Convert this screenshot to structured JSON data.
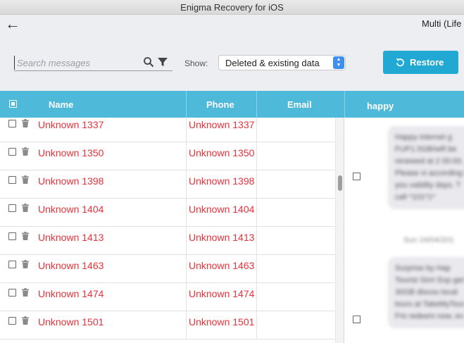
{
  "window": {
    "title": "Enigma Recovery for iOS"
  },
  "toolbar": {
    "device_name": "Multi (Life",
    "search_placeholder": "Search messages",
    "show_label": "Show:",
    "show_value": "Deleted & existing data",
    "restore_label": "Restore"
  },
  "table": {
    "headers": {
      "name": "Name",
      "phone": "Phone",
      "email": "Email",
      "conversation": "happy"
    },
    "rows": [
      {
        "name": "Unknown 1337",
        "phone": "Unknown 1337",
        "email": ""
      },
      {
        "name": "Unknown 1350",
        "phone": "Unknown 1350",
        "email": ""
      },
      {
        "name": "Unknown 1398",
        "phone": "Unknown 1398",
        "email": ""
      },
      {
        "name": "Unknown 1404",
        "phone": "Unknown 1404",
        "email": ""
      },
      {
        "name": "Unknown 1413",
        "phone": "Unknown 1413",
        "email": ""
      },
      {
        "name": "Unknown 1463",
        "phone": "Unknown 1463",
        "email": ""
      },
      {
        "name": "Unknown 1474",
        "phone": "Unknown 1474",
        "email": ""
      },
      {
        "name": "Unknown 1501",
        "phone": "Unknown 1501",
        "email": ""
      }
    ]
  },
  "messages": {
    "items": [
      {
        "text": "Happy internet g FUP1.5GB/wifi be renewed at 2 00:00. Please vi according to you validity days. T call *101*1*"
      },
      {
        "text": "Surprise by Hap Tourist Sim! Exp get 30GB discou local tours at TakeMyTour. Fre redeem now, ex"
      }
    ],
    "date": "Sun 24/04/201"
  },
  "colors": {
    "header": "#4fb9d9",
    "restore": "#21a9d3",
    "deleted_text": "#e8323c",
    "select_accent": "#3d8ff0"
  }
}
